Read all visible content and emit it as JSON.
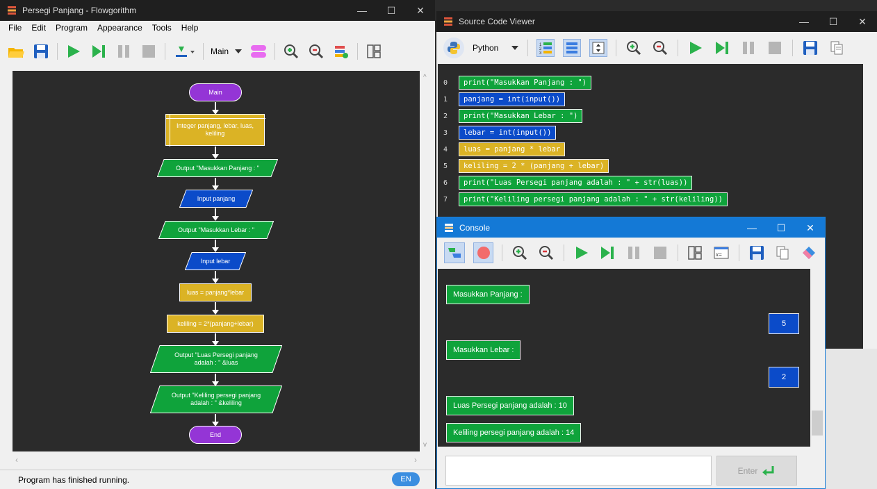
{
  "flowgorithm": {
    "title": "Persegi Panjang - Flowgorithm",
    "menu": [
      "File",
      "Edit",
      "Program",
      "Appearance",
      "Tools",
      "Help"
    ],
    "function_select": "Main",
    "status": "Program has finished running.",
    "lang_badge": "EN",
    "shapes": {
      "main": "Main",
      "declare": "Integer panjang, lebar, luas, keliling",
      "out1": "Output \"Masukkan Panjang : \"",
      "in1": "Input panjang",
      "out2": "Output \"Masukkan Lebar : \"",
      "in2": "Input lebar",
      "assign1": "luas = panjang*lebar",
      "assign2": "keliling = 2*(panjang+lebar)",
      "out3": "Output \"Luas Persegi panjang adalah : \" &luas",
      "out4": "Output \"Keliling persegi panjang adalah : \" &keliling",
      "end": "End"
    }
  },
  "source_viewer": {
    "title": "Source Code Viewer",
    "language": "Python",
    "lines": [
      {
        "num": "0",
        "code": "print(\"Masukkan Panjang : \")",
        "color": "green"
      },
      {
        "num": "1",
        "code": "panjang = int(input())",
        "color": "blue"
      },
      {
        "num": "2",
        "code": "print(\"Masukkan Lebar : \")",
        "color": "green"
      },
      {
        "num": "3",
        "code": "lebar = int(input())",
        "color": "blue"
      },
      {
        "num": "4",
        "code": "luas = panjang * lebar",
        "color": "yellow"
      },
      {
        "num": "5",
        "code": "keliling = 2 * (panjang + lebar)",
        "color": "yellow"
      },
      {
        "num": "6",
        "code": "print(\"Luas Persegi panjang adalah : \" + str(luas))",
        "color": "green"
      },
      {
        "num": "7",
        "code": "print(\"Keliling persegi panjang adalah : \" + str(keliling))",
        "color": "green"
      }
    ]
  },
  "console": {
    "title": "Console",
    "messages": [
      {
        "text": "Masukkan Panjang :",
        "side": "left"
      },
      {
        "text": "5",
        "side": "right"
      },
      {
        "text": "Masukkan Lebar :",
        "side": "left"
      },
      {
        "text": "2",
        "side": "right"
      },
      {
        "text": "Luas Persegi panjang adalah : 10",
        "side": "left"
      },
      {
        "text": "Keliling persegi panjang adalah : 14",
        "side": "left"
      }
    ],
    "enter_label": "Enter"
  }
}
